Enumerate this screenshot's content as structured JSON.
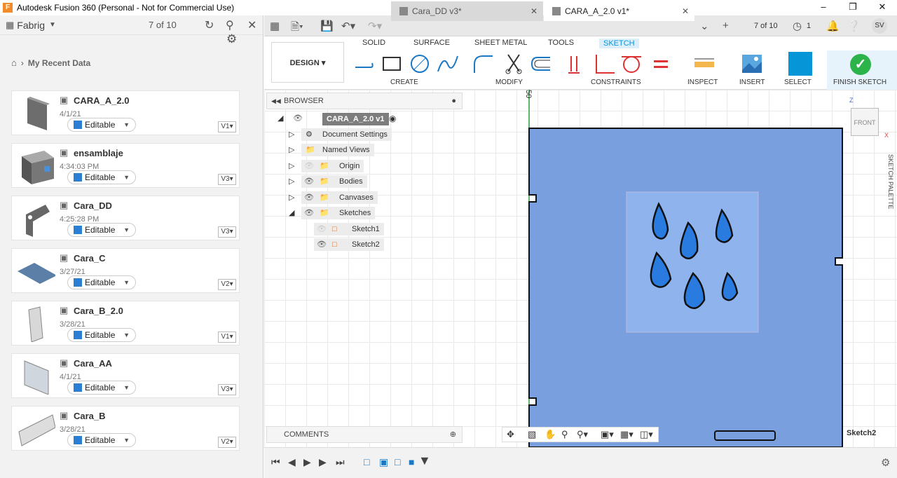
{
  "window": {
    "title": "Autodesk Fusion 360 (Personal - Not for Commercial Use)",
    "app_icon": "F"
  },
  "left_panel": {
    "project": "Fabrig",
    "count": "7 of 10",
    "breadcrumb": "My Recent Data",
    "items": [
      {
        "name": "CARA_A_2.0",
        "date": "4/1/21",
        "status": "Editable",
        "version": "V1"
      },
      {
        "name": "ensamblaje",
        "date": "4:34:03 PM",
        "status": "Editable",
        "version": "V3"
      },
      {
        "name": "Cara_DD",
        "date": "4:25:28 PM",
        "status": "Editable",
        "version": "V3"
      },
      {
        "name": "Cara_C",
        "date": "3/27/21",
        "status": "Editable",
        "version": "V2"
      },
      {
        "name": "Cara_B_2.0",
        "date": "3/28/21",
        "status": "Editable",
        "version": "V1"
      },
      {
        "name": "Cara_AA",
        "date": "4/1/21",
        "status": "Editable",
        "version": "V3"
      },
      {
        "name": "Cara_B",
        "date": "3/28/21",
        "status": "Editable",
        "version": "V2"
      }
    ]
  },
  "tabs": [
    {
      "label": "Cara_DD v3*"
    },
    {
      "label": "CARA_A_2.0 v1*"
    }
  ],
  "tab_right": {
    "count": "7 of 10",
    "jobs": "1",
    "user": "SV"
  },
  "ribbon": {
    "workspace": "DESIGN",
    "tabs": [
      "SOLID",
      "SURFACE",
      "SHEET METAL",
      "TOOLS",
      "SKETCH"
    ],
    "groups": [
      "CREATE",
      "MODIFY",
      "CONSTRAINTS",
      "INSPECT",
      "INSERT",
      "SELECT",
      "FINISH SKETCH"
    ]
  },
  "browser": {
    "title": "BROWSER",
    "root": "CARA_A_2.0 v1",
    "items": [
      "Document Settings",
      "Named Views",
      "Origin",
      "Bodies",
      "Canvases",
      "Sketches",
      "Sketch1",
      "Sketch2"
    ]
  },
  "comments": {
    "title": "COMMENTS"
  },
  "viewcube": {
    "label": "FRONT",
    "z": "Z",
    "x": "X"
  },
  "palette": {
    "label": "SKETCH PALETTE"
  },
  "canvas": {
    "dim_label": "50",
    "active_sketch": "Sketch2"
  },
  "colors": {
    "accent": "#0696d7",
    "body": "#7a9fde",
    "finish": "#2cb34a"
  }
}
